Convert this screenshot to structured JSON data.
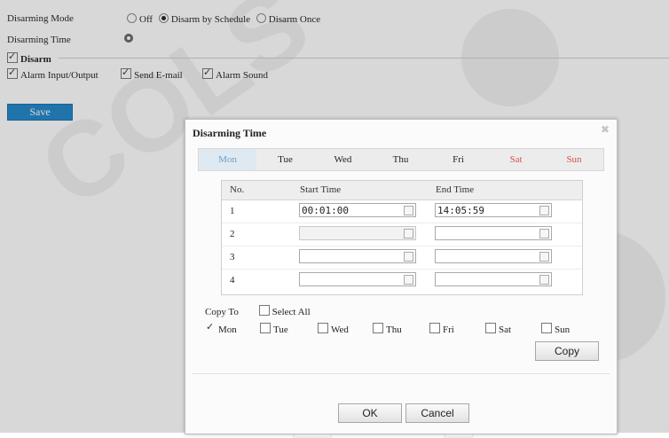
{
  "form": {
    "disarming_mode_label": "Disarming Mode",
    "mode_options": [
      {
        "label": "Off",
        "selected": false
      },
      {
        "label": "Disarm by Schedule",
        "selected": true
      },
      {
        "label": "Disarm Once",
        "selected": false
      }
    ],
    "disarming_time_label": "Disarming Time",
    "disarm_section_label": "Disarm",
    "disarm_checked": true,
    "options": [
      {
        "label": "Alarm Input/Output",
        "checked": true
      },
      {
        "label": "Send E-mail",
        "checked": true
      },
      {
        "label": "Alarm Sound",
        "checked": true
      }
    ],
    "save_label": "Save"
  },
  "dialog": {
    "title": "Disarming Time",
    "close_icon": "close-icon",
    "days": [
      "Mon",
      "Tue",
      "Wed",
      "Thu",
      "Fri",
      "Sat",
      "Sun"
    ],
    "active_day": "Mon",
    "table": {
      "headers": [
        "No.",
        "Start Time",
        "End Time"
      ],
      "rows": [
        {
          "no": "1",
          "start": "00:01:00",
          "end": "14:05:59"
        },
        {
          "no": "2",
          "start": "",
          "end": ""
        },
        {
          "no": "3",
          "start": "",
          "end": ""
        },
        {
          "no": "4",
          "start": "",
          "end": ""
        }
      ]
    },
    "copy_to_label": "Copy To",
    "select_all_label": "Select All",
    "copy_days": [
      {
        "label": "Mon",
        "checked": true
      },
      {
        "label": "Tue",
        "checked": false
      },
      {
        "label": "Wed",
        "checked": false
      },
      {
        "label": "Thu",
        "checked": false
      },
      {
        "label": "Fri",
        "checked": false
      },
      {
        "label": "Sat",
        "checked": false
      },
      {
        "label": "Sun",
        "checked": false
      }
    ],
    "copy_label": "Copy",
    "ok_label": "OK",
    "cancel_label": "Cancel"
  },
  "colors": {
    "save_button": "#1f86c8",
    "active_tab_text": "#6ea0c8",
    "weekend_text": "#d9534f"
  }
}
